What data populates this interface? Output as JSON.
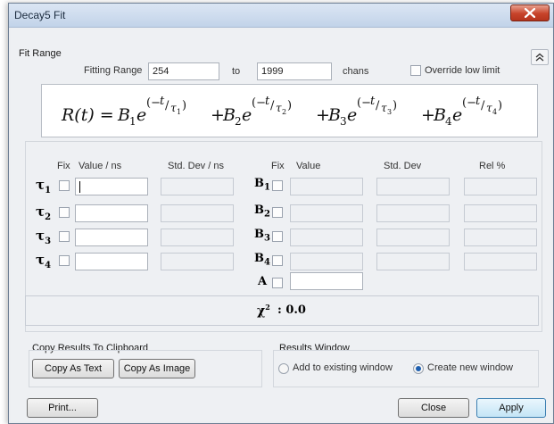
{
  "window": {
    "title": "Decay5  Fit"
  },
  "fit_range": {
    "group_title": "Fit Range",
    "label": "Fitting Range",
    "from_value": "254",
    "to_label": "to",
    "to_value": "1999",
    "unit": "chans",
    "override_label": "Override low limit"
  },
  "formula": {
    "lhs": "R(t) = ",
    "terms": [
      {
        "coef": "B",
        "idx": "1",
        "tau": "1"
      },
      {
        "coef": "B",
        "idx": "2",
        "tau": "2"
      },
      {
        "coef": "B",
        "idx": "3",
        "tau": "3"
      },
      {
        "coef": "B",
        "idx": "4",
        "tau": "4"
      }
    ]
  },
  "params": {
    "headers": {
      "tau_fix": "Fix",
      "tau_value": "Value / ns",
      "tau_std": "Std. Dev / ns",
      "b_fix": "Fix",
      "b_value": "Value",
      "b_std": "Std. Dev",
      "b_rel": "Rel %"
    },
    "tau_rows": [
      {
        "sym": "τ",
        "sub": "1",
        "value": ""
      },
      {
        "sym": "τ",
        "sub": "2",
        "value": ""
      },
      {
        "sym": "τ",
        "sub": "3",
        "value": ""
      },
      {
        "sym": "τ",
        "sub": "4",
        "value": ""
      }
    ],
    "b_rows": [
      {
        "sym": "B",
        "sub": "1"
      },
      {
        "sym": "B",
        "sub": "2"
      },
      {
        "sym": "B",
        "sub": "3"
      },
      {
        "sym": "B",
        "sub": "4"
      }
    ],
    "a_label": "A",
    "a_value": ""
  },
  "chi": {
    "label": "χ",
    "sup": "2",
    "value": ": 0.0"
  },
  "clipboard": {
    "group_title": "Copy Results To Clipboard",
    "copy_text": "Copy As Text",
    "copy_image": "Copy As Image"
  },
  "results_window": {
    "group_title": "Results Window",
    "option_add": "Add to existing window",
    "option_new": "Create new window",
    "selected": "Create new window"
  },
  "buttons": {
    "print": "Print...",
    "close": "Close",
    "apply": "Apply"
  },
  "colors": {
    "titlebar": "#c2d3e9",
    "close_red": "#c7432a",
    "radio_dot": "#1e5fb0"
  }
}
